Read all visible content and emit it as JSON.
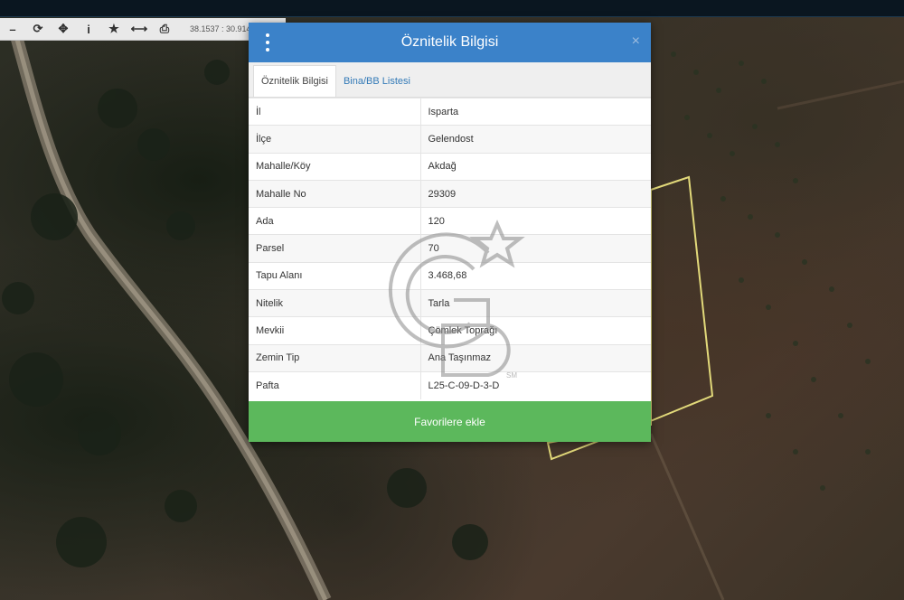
{
  "toolbar": {
    "coordinates": "38.1537 : 30.9140",
    "icons": [
      "refresh-icon",
      "pan-icon",
      "info-icon",
      "star-icon",
      "measure-icon",
      "print-icon"
    ]
  },
  "dialog": {
    "title": "Öznitelik Bilgisi",
    "close": "×",
    "tabs": [
      {
        "label": "Öznitelik Bilgisi",
        "active": true
      },
      {
        "label": "Bina/BB Listesi",
        "active": false
      }
    ],
    "rows": [
      {
        "key": "İl",
        "value": "Isparta"
      },
      {
        "key": "İlçe",
        "value": "Gelendost"
      },
      {
        "key": "Mahalle/Köy",
        "value": "Akdağ"
      },
      {
        "key": "Mahalle No",
        "value": "29309"
      },
      {
        "key": "Ada",
        "value": "120"
      },
      {
        "key": "Parsel",
        "value": "70"
      },
      {
        "key": "Tapu Alanı",
        "value": "3.468,68"
      },
      {
        "key": "Nitelik",
        "value": "Tarla"
      },
      {
        "key": "Mevkii",
        "value": "Çömlek Toprağı"
      },
      {
        "key": "Zemin Tip",
        "value": "Ana Taşınmaz"
      },
      {
        "key": "Pafta",
        "value": "L25-C-09-D-3-D"
      }
    ],
    "favorite_button": "Favorilere ekle"
  },
  "watermark": {
    "mark": "GM",
    "suffix": "SM"
  },
  "colors": {
    "header": "#3b82c9",
    "favorite": "#5cb85c",
    "parcel": "#e2d97a"
  }
}
